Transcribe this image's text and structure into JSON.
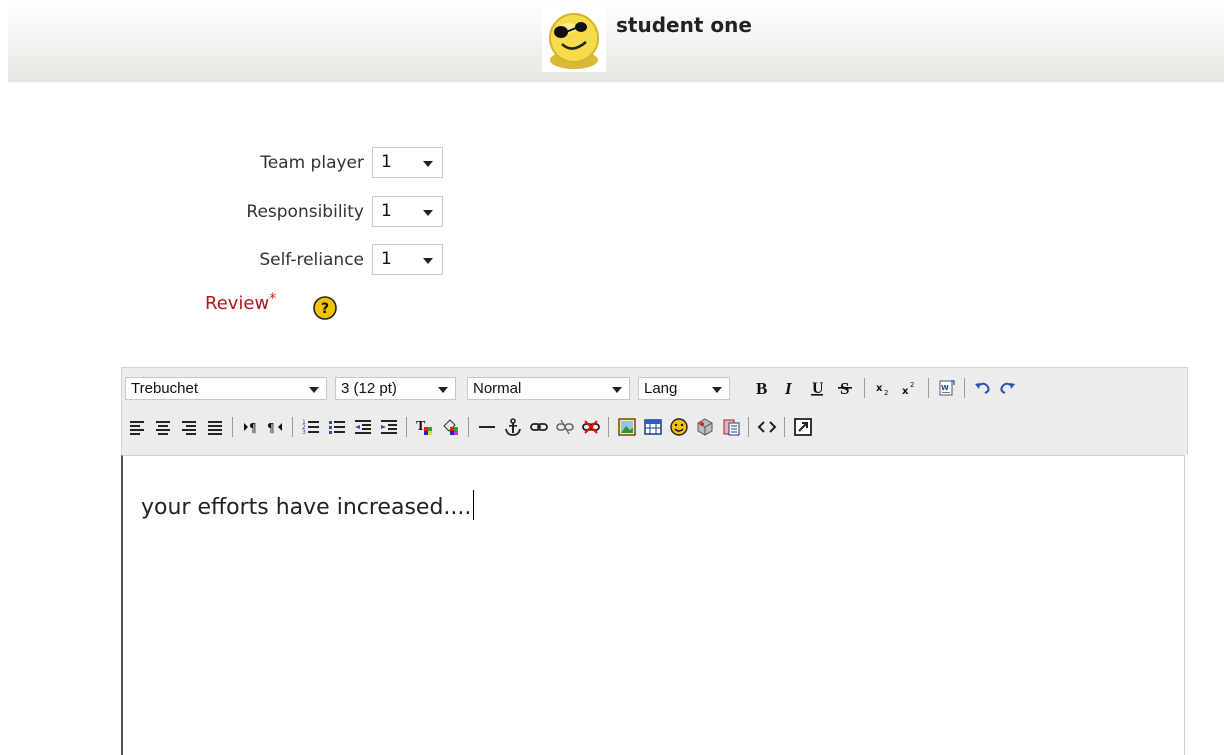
{
  "header": {
    "student_name": "student one",
    "avatar_icon": "smiley-sunglasses-icon"
  },
  "ratings": [
    {
      "label": "Team player",
      "value": "1"
    },
    {
      "label": "Responsibility",
      "value": "1"
    },
    {
      "label": "Self-reliance",
      "value": "1"
    }
  ],
  "review": {
    "label": "Review",
    "required_marker": "*",
    "help_icon": "help-icon"
  },
  "toolbar": {
    "font_family": "Trebuchet",
    "font_size": "3 (12 pt)",
    "format": "Normal",
    "language": "Lang"
  },
  "editor": {
    "content": "your efforts have increased...."
  },
  "colors": {
    "required": "#b01818",
    "toolbar_bg": "#ececec"
  }
}
